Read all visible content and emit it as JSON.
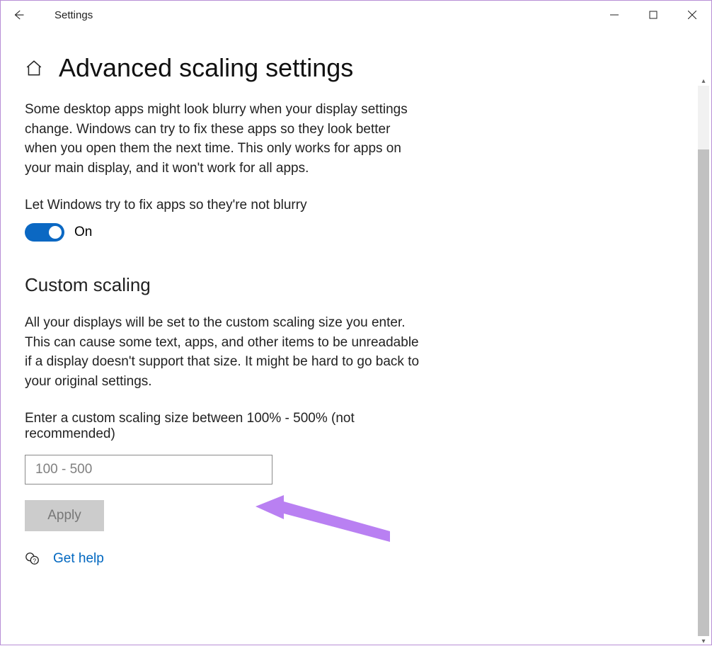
{
  "window": {
    "title": "Settings"
  },
  "header": {
    "title": "Advanced scaling settings"
  },
  "intro": "Some desktop apps might look blurry when your display settings change. Windows can try to fix these apps so they look better when you open them the next time. This only works for apps on your main display, and it won't work for all apps.",
  "fix_blurry": {
    "label": "Let Windows try to fix apps so they're not blurry",
    "state_text": "On",
    "on": true
  },
  "custom_scaling": {
    "heading": "Custom scaling",
    "desc": "All your displays will be set to the custom scaling size you enter. This can cause some text, apps, and other items to be unreadable if a display doesn't support that size. It might be hard to go back to your original settings.",
    "input_label": "Enter a custom scaling size between 100% - 500% (not recommended)",
    "placeholder": "100 - 500",
    "apply_label": "Apply"
  },
  "help": {
    "link_text": "Get help"
  },
  "icons": {
    "home": "home-icon",
    "back": "back-icon",
    "help": "help-icon"
  }
}
